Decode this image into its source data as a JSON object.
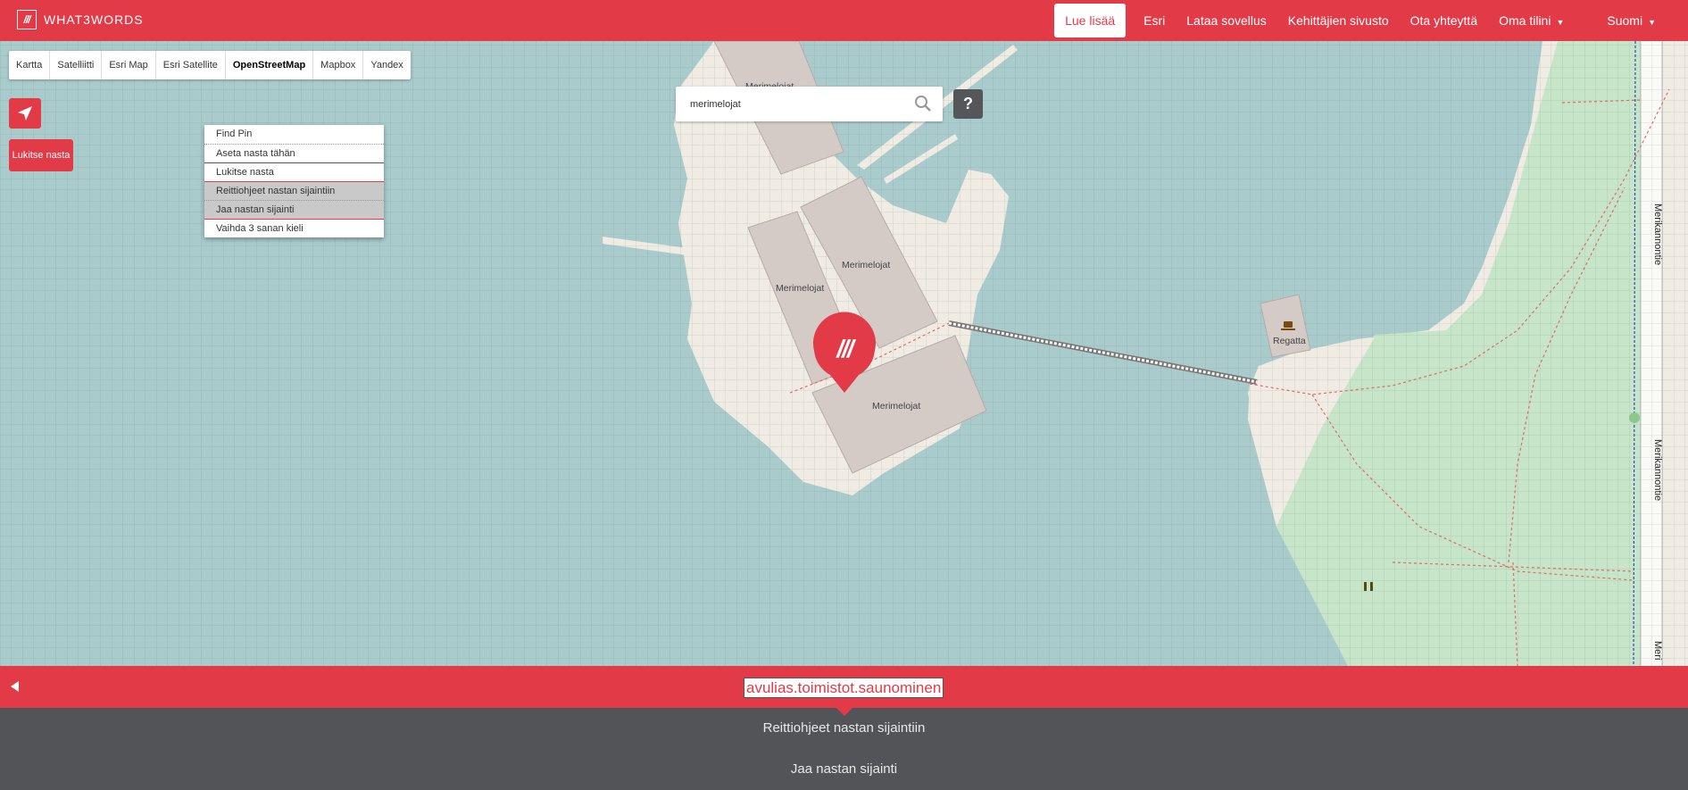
{
  "brand": {
    "logo_mark": "///",
    "name": "WHAT3WORDS"
  },
  "nav": {
    "items": [
      "Lue lisää",
      "Esri",
      "Lataa sovellus",
      "Kehittäjien sivusto",
      "Ota yhteyttä",
      "Oma tilini",
      "Suomi"
    ],
    "active": "Lue lisää"
  },
  "layers": [
    "Kartta",
    "Satelliitti",
    "Esri Map",
    "Esri Satellite",
    "OpenStreetMap",
    "Mapbox",
    "Yandex"
  ],
  "active_layer": "OpenStreetMap",
  "lock_button": "Lukitse nasta",
  "context_menu": [
    "Find Pin",
    "Aseta nasta tähän",
    "Lukitse nasta",
    "Reittiohjeet nastan sijaintiin",
    "Jaa nastan sijainti",
    "Vaihda 3 sanan kieli"
  ],
  "search": {
    "value": "merimelojat"
  },
  "help_label": "?",
  "map_labels": {
    "building_top": "Merimelojat",
    "building_a": "Merimelojat",
    "building_b": "Merimelojat",
    "building_c": "Merimelojat",
    "cafe": "Regatta",
    "road_1": "Merikannontie",
    "road_2": "Merikannontie",
    "road_3": "Meri"
  },
  "address": "avulias.toimistot.saunominen",
  "actions": [
    "Reittiohjeet nastan sijaintiin",
    "Jaa nastan sijainti"
  ],
  "colors": {
    "brand_red": "#e23b47",
    "panel_dark": "#525458",
    "water": "#aacbcc",
    "land": "#f0ece4",
    "park": "#c7e5c8",
    "building": "#d4cbc7"
  },
  "icons": [
    "locate-arrow-icon",
    "search-icon",
    "pin-icon",
    "cafe-icon",
    "toilet-icon"
  ]
}
